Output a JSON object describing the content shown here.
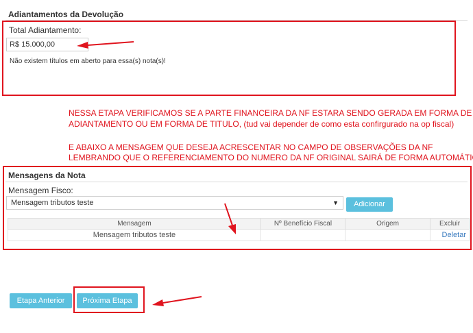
{
  "adiantamentos": {
    "title": "Adiantamentos da Devolução",
    "total_label": "Total Adiantamento:",
    "total_value": "R$ 15.000,00",
    "no_titles_msg": "Não existem títulos em aberto para essa(s) nota(s)!"
  },
  "annotations": {
    "line1": "NESSA ETAPA VERIFICAMOS SE A PARTE FINANCEIRA DA NF ESTARA SENDO GERADA EM FORMA DE",
    "line2": "ADIANTAMENTO OU EM FORMA DE TITULO, (tud vai depender de como esta confirgurado na op fiscal)",
    "line3": "E ABAIXO A MENSAGEM QUE DESEJA ACRESCENTAR NO CAMPO DE OBSERVAÇÕES DA NF",
    "line4": "LEMBRANDO QUE O REFERENCIAMENTO DO NUMERO DA NF ORIGINAL SAIRÁ DE FORMA AUTOMÁTICA."
  },
  "mensagens": {
    "title": "Mensagens da Nota",
    "fisco_label": "Mensagem Fisco:",
    "fisco_selected": "Mensagem tributos teste",
    "add_button": "Adicionar",
    "table": {
      "headers": [
        "Mensagem",
        "Nº Benefício Fiscal",
        "Origem",
        "Excluir"
      ],
      "rows": [
        {
          "mensagem": "Mensagem tributos teste",
          "beneficio": "",
          "origem": "",
          "excluir": "Deletar"
        }
      ]
    }
  },
  "nav": {
    "prev_button": "Etapa Anterior",
    "next_button": "Próxima Etapa"
  },
  "colors": {
    "annotation_red": "#e0141e",
    "button_blue": "#5bc0de",
    "link_blue": "#3a7bbf"
  }
}
